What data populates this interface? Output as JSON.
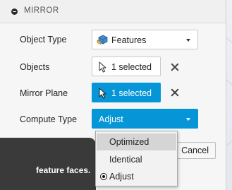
{
  "dialog": {
    "title": "MIRROR",
    "rows": {
      "object_type": {
        "label": "Object Type",
        "value": "Features"
      },
      "objects": {
        "label": "Objects",
        "value": "1 selected"
      },
      "mirror_plane": {
        "label": "Mirror Plane",
        "value": "1 selected"
      },
      "compute_type": {
        "label": "Compute Type",
        "value": "Adjust"
      }
    },
    "cancel_label": "Cancel"
  },
  "compute_menu": {
    "items": [
      "Optimized",
      "Identical",
      "Adjust"
    ],
    "hovered": "Optimized",
    "selected": "Adjust"
  },
  "tooltip": {
    "text": "feature faces."
  },
  "colors": {
    "accent": "#0696d7",
    "panel": "#f6f6f6",
    "tooltip_bg": "#3a3a3a"
  }
}
